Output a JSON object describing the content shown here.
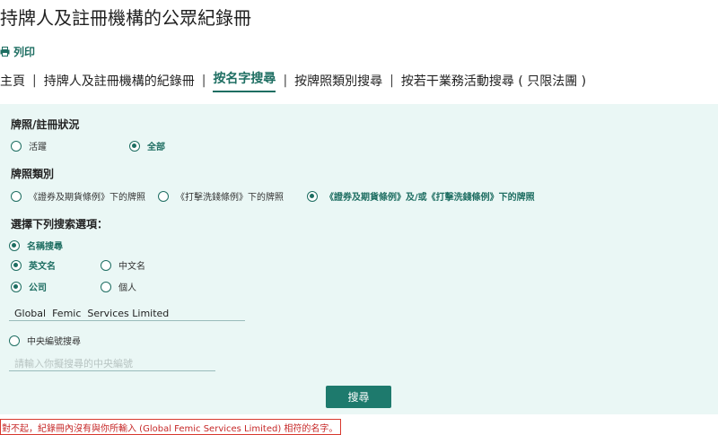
{
  "page": {
    "title": "持牌人及註冊機構的公眾紀錄冊"
  },
  "print": {
    "label": "列印"
  },
  "nav": {
    "items": [
      {
        "label": "主頁"
      },
      {
        "label": "持牌人及註冊機構的紀錄冊"
      },
      {
        "label": "按名字搜尋",
        "active": true
      },
      {
        "label": "按牌照類別搜尋"
      },
      {
        "label": "按若干業務活動搜尋 ( 只限法團 )"
      }
    ],
    "separator": "|"
  },
  "license_status": {
    "label": "牌照/註冊狀況",
    "options": [
      {
        "label": "活躍",
        "selected": false
      },
      {
        "label": "全部",
        "selected": true
      }
    ]
  },
  "license_type": {
    "label": "牌照類別",
    "options": [
      {
        "label": "《證券及期貨條例》下的牌照",
        "selected": false
      },
      {
        "label": "《打擊洗錢條例》下的牌照",
        "selected": false
      },
      {
        "label": "《證券及期貨條例》及/或《打擊洗錢條例》下的牌照",
        "selected": true
      }
    ]
  },
  "search_options": {
    "label": "選擇下列搜索選項：",
    "name_search": {
      "label": "名稱搜尋",
      "selected": true
    },
    "english_name": {
      "label": "英文名",
      "selected": true
    },
    "chinese_name": {
      "label": "中文名",
      "selected": false
    },
    "company": {
      "label": "公司",
      "selected": true
    },
    "individual": {
      "label": "個人",
      "selected": false
    },
    "name_input": {
      "value": "Global  Femic  Services Limited"
    },
    "ce_search": {
      "label": "中央編號搜尋",
      "selected": false
    },
    "ce_input": {
      "placeholder": "請輸入你擬搜尋的中央編號"
    }
  },
  "search_button": {
    "label": "搜尋"
  },
  "message": {
    "text": "對不起，紀錄冊內沒有與你所輸入 (Global Femic Services Limited) 相符的名字。"
  },
  "colors": {
    "accent": "#1e6e62",
    "panel_bg": "#eaf7f5",
    "error": "#c62828"
  },
  "icons": {
    "print": "printer-icon"
  }
}
